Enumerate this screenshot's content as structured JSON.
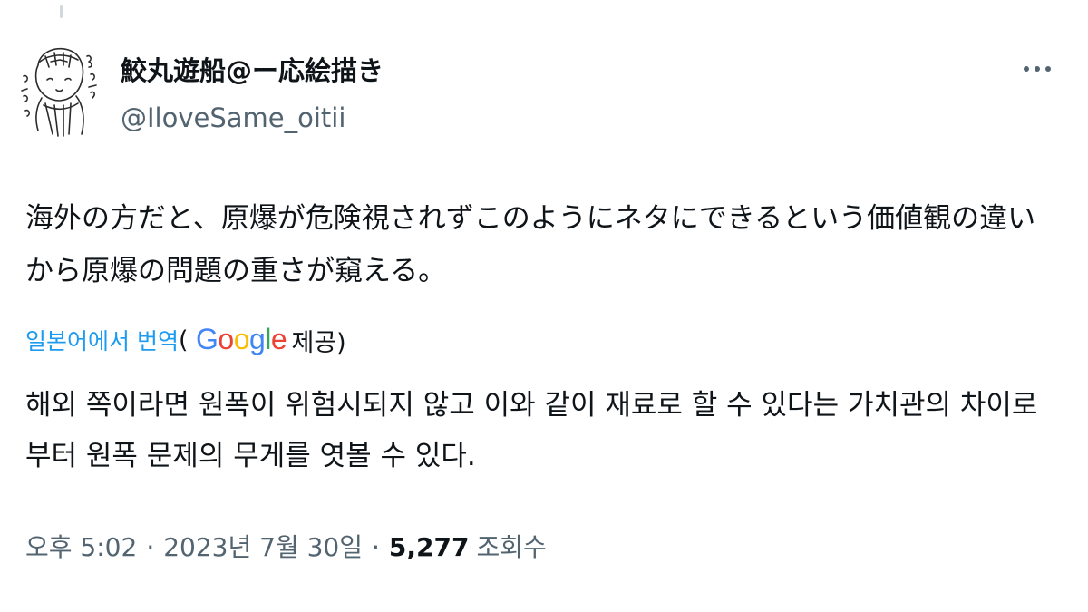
{
  "author": {
    "display_name": "鮫丸遊船@ー応絵描き",
    "handle": "@IloveSame_oitii"
  },
  "tweet": {
    "text_line1": "海外の方だと、原爆が危険視されずこのようにネタにできるという価値観の違い",
    "text_line2": "から原爆の問題の重さが窺える。"
  },
  "translation": {
    "link_label": "일본어에서 번역",
    "paren_open": "(",
    "provider_name": "Google",
    "provided_label": "제공)",
    "text_line1": "해외 쪽이라면 원폭이 위험시되지 않고 이와 같이 재료로 할 수 있다는 가치관의 차이로",
    "text_line2": "부터 원폭 문제의 무게를 엿볼 수 있다."
  },
  "meta": {
    "time": "오후 5:02",
    "separator": "·",
    "date": "2023년 7월 30일",
    "views_count": "5,277",
    "views_label": "조회수"
  },
  "colors": {
    "text_primary": "#0f1419",
    "text_secondary": "#536471",
    "link": "#1d9bf0",
    "google_blue": "#4285F4",
    "google_red": "#EA4335",
    "google_yellow": "#FBBC05",
    "google_green": "#34A853"
  },
  "icons": {
    "avatar": "sketch-avatar",
    "more": "more-horizontal-icon",
    "google_logo": "google-logo"
  }
}
